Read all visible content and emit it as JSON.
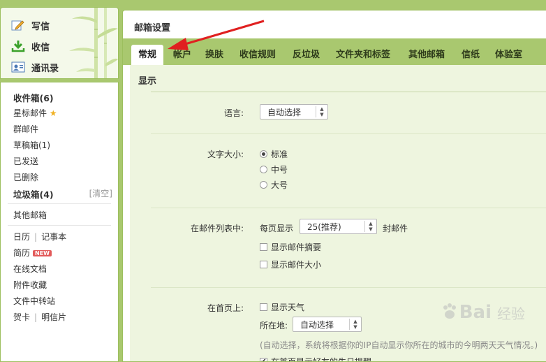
{
  "actions": {
    "compose": "写信",
    "receive": "收信",
    "contacts": "通讯录"
  },
  "folders": {
    "inbox": "收件箱(6)",
    "starred": "星标邮件",
    "group": "群邮件",
    "drafts": "草稿箱(1)",
    "sent": "已发送",
    "deleted": "已删除",
    "spam": "垃圾箱(4)",
    "spam_clear": "[清空]",
    "other_mailbox": "其他邮箱",
    "calendar": "日历",
    "notes": "记事本",
    "resume": "简历",
    "new_badge": "NEW",
    "online_docs": "在线文档",
    "attachments": "附件收藏",
    "file_transfer": "文件中转站",
    "greeting_card": "贺卡",
    "postcard": "明信片"
  },
  "main": {
    "title": "邮箱设置",
    "tabs": [
      "常规",
      "帐户",
      "换肤",
      "收信规则",
      "反垃圾",
      "文件夹和标签",
      "其他邮箱",
      "信纸",
      "体验室"
    ],
    "active_tab": "常规"
  },
  "settings": {
    "section_title": "显示",
    "language": {
      "label": "语言:",
      "value": "自动选择"
    },
    "font_size": {
      "label": "文字大小:",
      "options": [
        "标准",
        "中号",
        "大号"
      ],
      "selected": "标准"
    },
    "mail_list": {
      "label": "在邮件列表中:",
      "per_page_prefix": "每页显示",
      "per_page_value": "25(推荐)",
      "per_page_suffix": "封邮件",
      "show_summary": "显示邮件摘要",
      "show_size": "显示邮件大小"
    },
    "homepage": {
      "label": "在首页上:",
      "show_weather": "显示天气",
      "location_label": "所在地:",
      "location_value": "自动选择",
      "location_note": "(自动选择，系统将根据你的IP自动显示你所在的城市的今明两天天气情况。)",
      "birthday_reminder": "在首页显示好友的生日提醒"
    }
  },
  "watermark": {
    "text": "Bai",
    "text2": "经验"
  },
  "colors": {
    "frame": "#a9c86f",
    "content_bg": "#eef5df",
    "arrow": "#e02020",
    "badge": "#e25a5a"
  }
}
